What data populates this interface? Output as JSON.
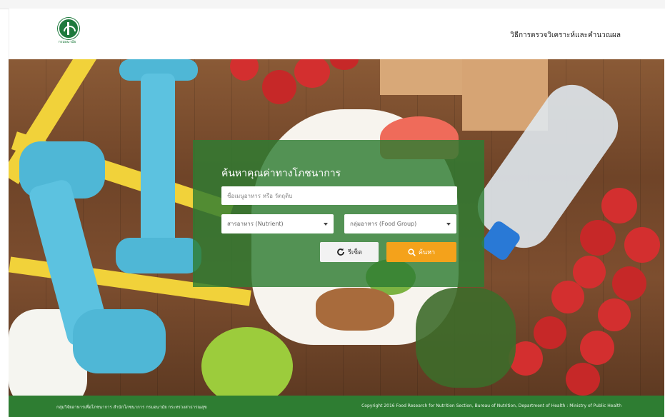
{
  "header": {
    "logo_text": "กรมอนามัย",
    "nav_link": "วิธีการตรวจวิเคราะห์และคำนวณผล"
  },
  "search": {
    "title": "ค้นหาคุณค่าทางโภชนาการ",
    "input_placeholder": "ชื่อเมนูอาหาร หรือ วัตถุดิบ",
    "input_value": "",
    "nutrient_select": "สารอาหาร (Nutrient)",
    "group_select": "กลุ่มอาหาร (Food Group)",
    "reset_label": "รีเซ็ต",
    "search_label": "ค้นหา"
  },
  "footer": {
    "left_text": "กลุ่มวิจัยอาหารเพื่อโภชนาการ สำนักโภชนาการ กรมอนามัย กระทรวงสาธารณสุข",
    "right_text": "Copyright 2016 Food Research for Nutrition Section, Bureau of Nutrition, Department of Health : Ministry of Public Health"
  },
  "colors": {
    "brand_green": "#2e7d32",
    "search_button": "#f4a21b"
  },
  "icons": {
    "reset": "refresh-icon",
    "search": "magnifier-icon"
  }
}
